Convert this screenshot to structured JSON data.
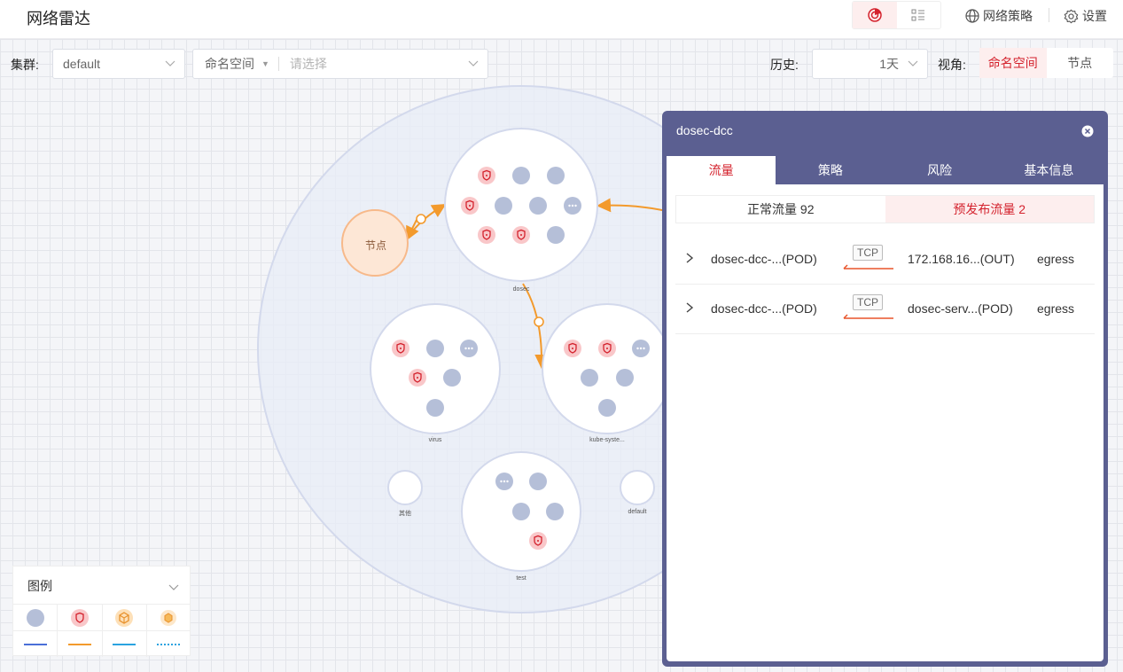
{
  "header": {
    "title": "网络雷达",
    "policy_label": "网络策略",
    "settings_label": "设置"
  },
  "filters": {
    "cluster_label": "集群:",
    "cluster_value": "default",
    "namespace_prefix": "命名空间",
    "namespace_placeholder": "请选择",
    "history_label": "历史:",
    "history_value": "1天",
    "view_label": "视角:",
    "view_options": [
      "命名空间",
      "节点"
    ]
  },
  "graph": {
    "node_label": "节点",
    "namespaces": [
      "dosec",
      "virus",
      "kube-syste...",
      "test",
      "其他",
      "default"
    ]
  },
  "legend": {
    "title": "图例"
  },
  "panel": {
    "title": "dosec-dcc",
    "tabs": [
      "流量",
      "策略",
      "风险",
      "基本信息"
    ],
    "subtabs": [
      "正常流量 92",
      "预发布流量 2"
    ],
    "flows": [
      {
        "src": "dosec-dcc-...(POD)",
        "protocol": "TCP",
        "dst": "172.168.16...(OUT)",
        "direction": "egress"
      },
      {
        "src": "dosec-dcc-...(POD)",
        "protocol": "TCP",
        "dst": "dosec-serv...(POD)",
        "direction": "egress"
      }
    ]
  },
  "colors": {
    "accent_red": "#d4222d",
    "panel_bg": "#5b5f91",
    "edge_orange": "#f39a2c",
    "pod_gray": "#b5bfd8"
  }
}
